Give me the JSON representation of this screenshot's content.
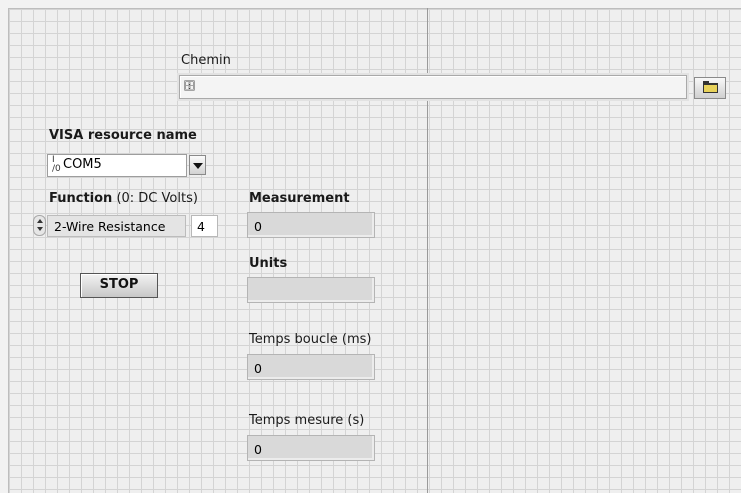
{
  "chemin": {
    "label": "Chemin",
    "path_icon": "path-icon",
    "value": "",
    "browse_icon": "folder-open-icon"
  },
  "visa": {
    "label": "VISA resource name",
    "icon": "visa-io-icon",
    "value": "COM5"
  },
  "function": {
    "label_bold": "Function",
    "label_rest": " (0: DC Volts)",
    "value": "2-Wire Resistance",
    "number": "4"
  },
  "stop": {
    "label": "STOP"
  },
  "measurement": {
    "label": "Measurement",
    "value": "0"
  },
  "units": {
    "label": "Units",
    "value": ""
  },
  "temps_boucle": {
    "label": "Temps boucle (ms)",
    "value": "0"
  },
  "temps_mesure": {
    "label": "Temps mesure (s)",
    "value": "0"
  },
  "colors": {
    "panel": "#efefef",
    "grid": "#d4d4d4",
    "indicator": "#d9d9d9"
  }
}
